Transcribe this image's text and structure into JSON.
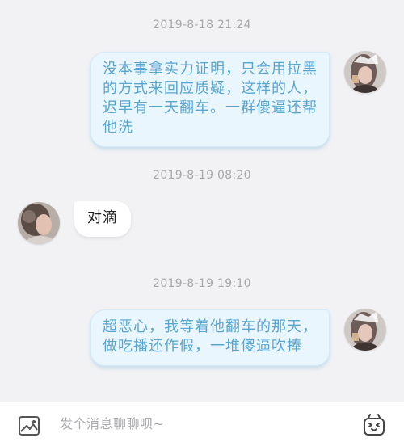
{
  "messages": [
    {
      "time": "2019-8-18 21:24",
      "sender": "me",
      "lines": [
        "没本事拿实力证明，只会用拉黑",
        "的方式来回应质疑，这样的人，",
        "迟早有一天翻车。一群傻逼还帮",
        "他洗"
      ]
    },
    {
      "time": "2019-8-19 08:20",
      "sender": "other",
      "lines": [
        "对滴"
      ]
    },
    {
      "time": "2019-8-19 19:10",
      "sender": "me",
      "lines": [
        "超恶心，我等着他翻车的那天，",
        "做吃播还作假，一堆傻逼吹捧"
      ]
    }
  ],
  "composer": {
    "placeholder": "发个消息聊聊呗~",
    "image_icon": "image-icon",
    "emoji_icon": "emoji-icon"
  },
  "colors": {
    "background": "#f2f2f4",
    "outgoing_bubble": "#eaf6fd",
    "outgoing_text": "#58a6d0",
    "incoming_bubble": "#ffffff",
    "incoming_text": "#222222",
    "timestamp_text": "#a8a8ac"
  }
}
